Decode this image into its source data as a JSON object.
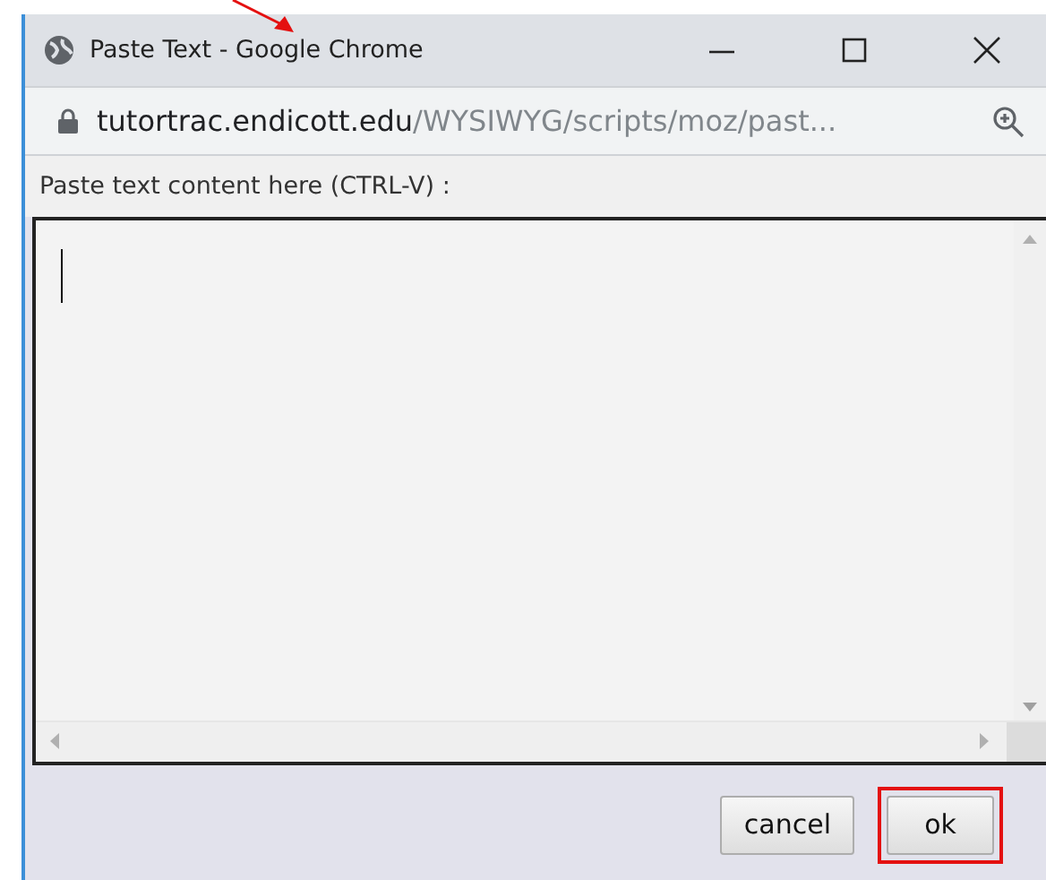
{
  "window": {
    "title": "Paste Text - Google Chrome"
  },
  "address_bar": {
    "host": "tutortrac.endicott.edu",
    "path": "/WYSIWYG/scripts/moz/past..."
  },
  "prompt": "Paste text content here (CTRL-V) :",
  "buttons": [
    {
      "label": "cancel",
      "highlighted": false
    },
    {
      "label": "ok",
      "highlighted": true
    }
  ]
}
